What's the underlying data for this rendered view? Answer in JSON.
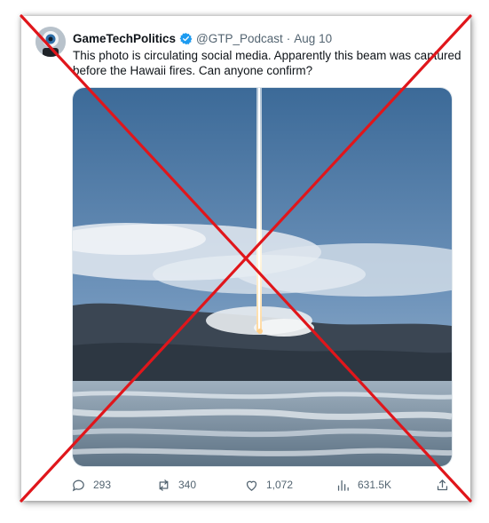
{
  "tweet": {
    "display_name": "GameTechPolitics",
    "handle": "@GTP_Podcast",
    "separator": "·",
    "date": "Aug 10",
    "text": "This photo is circulating social media. Apparently this beam was captured before the Hawaii fires. Can anyone confirm?",
    "verified_color": "#1d9bf0"
  },
  "actions": {
    "replies": "293",
    "retweets": "340",
    "likes": "1,072",
    "views": "631.5K"
  },
  "overlay_color": "#e0161b",
  "icons": [
    "reply-icon",
    "retweet-icon",
    "like-icon",
    "views-icon",
    "share-icon",
    "verified-badge-icon"
  ]
}
